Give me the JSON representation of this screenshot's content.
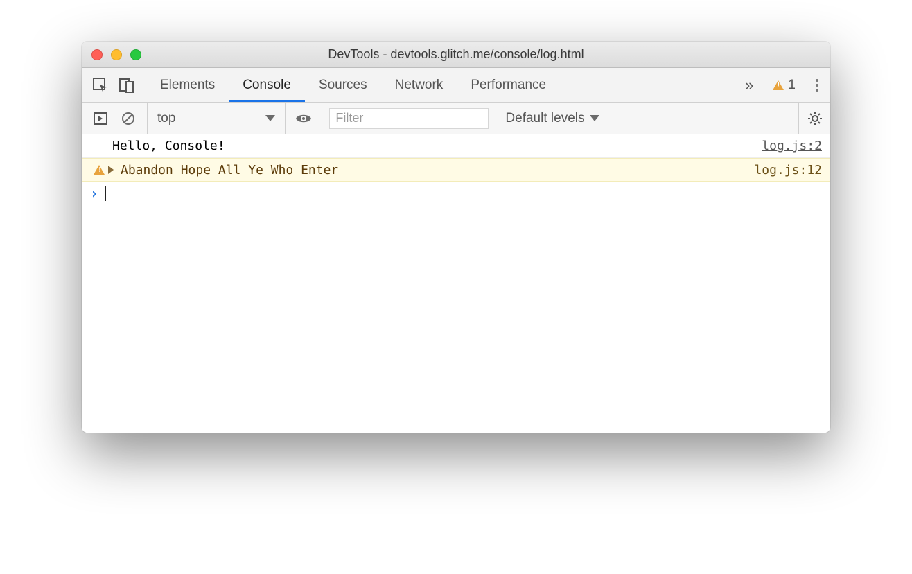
{
  "window": {
    "title": "DevTools - devtools.glitch.me/console/log.html"
  },
  "tabs": {
    "items": [
      "Elements",
      "Console",
      "Sources",
      "Network",
      "Performance"
    ],
    "active_index": 1,
    "overflow_glyph": "»",
    "warning_count": "1"
  },
  "toolbar": {
    "context": "top",
    "filter_placeholder": "Filter",
    "levels_label": "Default levels"
  },
  "console": {
    "lines": [
      {
        "type": "log",
        "message": "Hello, Console!",
        "source": "log.js:2"
      },
      {
        "type": "warn",
        "message": "Abandon Hope All Ye Who Enter",
        "source": "log.js:12"
      }
    ],
    "prompt_glyph": "›"
  }
}
